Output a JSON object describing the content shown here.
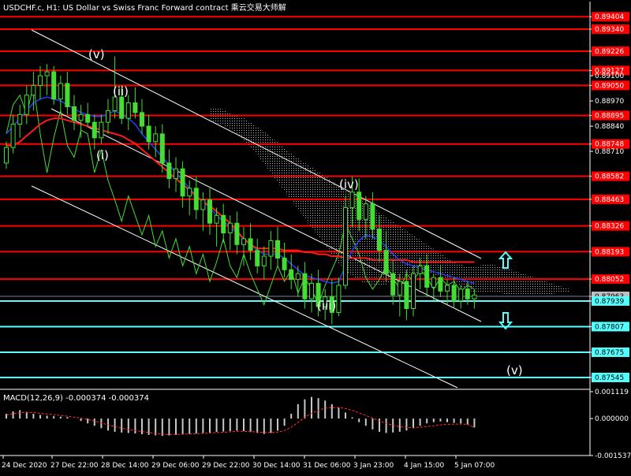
{
  "chart_title": "USDCHF.c, H1: US Dollar vs Swiss Franc Forward contract  乘云交易大师解",
  "indicator_label": "MACD(12,26,9) -0.000374 -0.000374",
  "colors": {
    "background": "#000000",
    "price": "#44dd33",
    "ma_red": "#ff1a1a",
    "ma_blue": "#2040ff",
    "channel": "#ffffff",
    "level_red": "#ff0000",
    "level_cyan": "#55ffff",
    "cloud": "#cccccc",
    "macd_bar": "#c8c8c8",
    "macd_signal": "#ff3030"
  },
  "chart_data": {
    "type": "candlestick",
    "symbol": "USDCHF.c",
    "timeframe": "H1",
    "x_ticks": [
      "24 Dec 2020",
      "27 Dec 22:00",
      "28 Dec 14:00",
      "29 Dec 06:00",
      "29 Dec 22:00",
      "30 Dec 14:00",
      "31 Dec 06:00",
      "3 Jan 23:00",
      "4 Jan 15:00",
      "5 Jan 07:00"
    ],
    "y_range": [
      0.87488,
      0.89482
    ],
    "y_axis_labels": [
      "0.89404",
      "0.89340",
      "0.89226",
      "0.89127",
      "0.89100",
      "0.89050",
      "0.88970",
      "0.88895",
      "0.88840",
      "0.88748",
      "0.88710",
      "0.88582",
      "0.88463",
      "0.88326",
      "0.88193",
      "0.88052",
      "0.87963",
      "0.87939",
      "0.87807",
      "0.87675",
      "0.87545"
    ],
    "resistance_levels": [
      "0.89404",
      "0.89340",
      "0.89226",
      "0.89127",
      "0.89050",
      "0.88895",
      "0.88748",
      "0.88582",
      "0.88463",
      "0.88326",
      "0.88193",
      "0.88052"
    ],
    "support_levels": [
      "0.87939",
      "0.87807",
      "0.87675",
      "0.87545"
    ],
    "current_price": "0.87963",
    "wave_labels": [
      "(v)",
      "(ii)",
      "(i)",
      "(iv)",
      "(iii)",
      "(v)"
    ],
    "arrows": [
      "up",
      "down"
    ],
    "macd": {
      "params": "12,26,9",
      "main": -0.000374,
      "signal": -0.000374,
      "y_labels": [
        "0.001119",
        "0.000000",
        "-0.001537"
      ]
    },
    "series": [
      {
        "type": "candlestick",
        "values": [
          [
            0.8865,
            0.8876,
            0.8862,
            0.8873
          ],
          [
            0.8873,
            0.889,
            0.887,
            0.8885
          ],
          [
            0.8885,
            0.8895,
            0.8878,
            0.889
          ],
          [
            0.889,
            0.8905,
            0.8885,
            0.89
          ],
          [
            0.89,
            0.8912,
            0.8892,
            0.8905
          ],
          [
            0.8905,
            0.8915,
            0.8898,
            0.891
          ],
          [
            0.891,
            0.8916,
            0.89,
            0.8912
          ],
          [
            0.8912,
            0.8915,
            0.8895,
            0.8898
          ],
          [
            0.8898,
            0.891,
            0.8892,
            0.8906
          ],
          [
            0.8906,
            0.8912,
            0.889,
            0.8894
          ],
          [
            0.8894,
            0.89,
            0.8882,
            0.8887
          ],
          [
            0.8887,
            0.8895,
            0.8878,
            0.889
          ],
          [
            0.889,
            0.8896,
            0.8884,
            0.8886
          ],
          [
            0.8886,
            0.889,
            0.8872,
            0.8878
          ],
          [
            0.8878,
            0.889,
            0.8875,
            0.8886
          ],
          [
            0.8886,
            0.8898,
            0.888,
            0.8892
          ],
          [
            0.8892,
            0.892,
            0.8888,
            0.8899
          ],
          [
            0.8899,
            0.8905,
            0.8885,
            0.8888
          ],
          [
            0.8888,
            0.89,
            0.8882,
            0.8896
          ],
          [
            0.8896,
            0.8904,
            0.8888,
            0.8891
          ],
          [
            0.8891,
            0.8898,
            0.888,
            0.8884
          ],
          [
            0.8884,
            0.889,
            0.8872,
            0.8876
          ],
          [
            0.8876,
            0.8884,
            0.8868,
            0.888
          ],
          [
            0.888,
            0.8885,
            0.886,
            0.8865
          ],
          [
            0.8865,
            0.8872,
            0.8852,
            0.8857
          ],
          [
            0.8857,
            0.8868,
            0.885,
            0.8862
          ],
          [
            0.8862,
            0.8866,
            0.8842,
            0.8848
          ],
          [
            0.8848,
            0.8856,
            0.8838,
            0.8852
          ],
          [
            0.8852,
            0.8858,
            0.8836,
            0.8841
          ],
          [
            0.8841,
            0.885,
            0.883,
            0.8846
          ],
          [
            0.8846,
            0.8852,
            0.8828,
            0.8834
          ],
          [
            0.8834,
            0.8842,
            0.8822,
            0.8838
          ],
          [
            0.8838,
            0.8844,
            0.8824,
            0.8829
          ],
          [
            0.8829,
            0.8838,
            0.882,
            0.8834
          ],
          [
            0.8834,
            0.884,
            0.8818,
            0.8823
          ],
          [
            0.8823,
            0.8832,
            0.8812,
            0.8826
          ],
          [
            0.8826,
            0.8834,
            0.8815,
            0.882
          ],
          [
            0.882,
            0.8826,
            0.8808,
            0.8812
          ],
          [
            0.8812,
            0.8822,
            0.8805,
            0.8817
          ],
          [
            0.8817,
            0.883,
            0.881,
            0.8825
          ],
          [
            0.8825,
            0.8832,
            0.8812,
            0.8816
          ],
          [
            0.8816,
            0.8824,
            0.8806,
            0.881
          ],
          [
            0.881,
            0.8818,
            0.88,
            0.8805
          ],
          [
            0.8805,
            0.8812,
            0.8796,
            0.8808
          ],
          [
            0.8808,
            0.8814,
            0.879,
            0.8795
          ],
          [
            0.8795,
            0.8808,
            0.8788,
            0.8803
          ],
          [
            0.8803,
            0.881,
            0.8786,
            0.8791
          ],
          [
            0.8791,
            0.88,
            0.8784,
            0.8796
          ],
          [
            0.8796,
            0.8805,
            0.8782,
            0.8788
          ],
          [
            0.8788,
            0.8806,
            0.8786,
            0.8802
          ],
          [
            0.8802,
            0.8848,
            0.88,
            0.8842
          ],
          [
            0.8842,
            0.8858,
            0.8832,
            0.885
          ],
          [
            0.885,
            0.8857,
            0.883,
            0.8836
          ],
          [
            0.8836,
            0.8848,
            0.8826,
            0.8844
          ],
          [
            0.8844,
            0.885,
            0.8826,
            0.8831
          ],
          [
            0.8831,
            0.8838,
            0.8814,
            0.882
          ],
          [
            0.882,
            0.883,
            0.8804,
            0.8808
          ],
          [
            0.8808,
            0.8815,
            0.8792,
            0.8797
          ],
          [
            0.8797,
            0.8808,
            0.8786,
            0.8804
          ],
          [
            0.8804,
            0.881,
            0.8784,
            0.879
          ],
          [
            0.879,
            0.8812,
            0.8786,
            0.8808
          ],
          [
            0.8808,
            0.8816,
            0.88,
            0.8812
          ],
          [
            0.8812,
            0.8818,
            0.8796,
            0.8801
          ],
          [
            0.8801,
            0.8808,
            0.8794,
            0.8806
          ],
          [
            0.8806,
            0.8812,
            0.8796,
            0.8799
          ],
          [
            0.8799,
            0.8805,
            0.8792,
            0.8802
          ],
          [
            0.8802,
            0.8806,
            0.879,
            0.8794
          ],
          [
            0.8794,
            0.8802,
            0.879,
            0.88
          ],
          [
            0.88,
            0.8804,
            0.8792,
            0.8795
          ],
          [
            0.8795,
            0.88,
            0.879,
            0.8797
          ]
        ]
      },
      {
        "name": "",
        "type": "line",
        "role": "slow_ma",
        "values": [
          0.8874,
          0.8874,
          0.8876,
          0.8879,
          0.8882,
          0.8885,
          0.8887,
          0.8888,
          0.8888,
          0.8887,
          0.8886,
          0.8885,
          0.8884,
          0.8883,
          0.8882,
          0.8881,
          0.888,
          0.8879,
          0.8877,
          0.8875,
          0.8872,
          0.8869,
          0.8866,
          0.8863,
          0.886,
          0.8857,
          0.8854,
          0.8851,
          0.8848,
          0.8845,
          0.8843,
          0.884,
          0.8837,
          0.8834,
          0.883,
          0.8826,
          0.8823,
          0.8821,
          0.8821,
          0.8821,
          0.8821,
          0.882,
          0.882,
          0.882,
          0.8819,
          0.8819,
          0.8818,
          0.8818,
          0.8817,
          0.8817,
          0.8816,
          0.8816,
          0.8816,
          0.8816,
          0.8815,
          0.8815,
          0.8815,
          0.8815,
          0.8815,
          0.8815,
          0.8814,
          0.8814,
          0.8814,
          0.8814,
          0.8814,
          0.8814,
          0.8814,
          0.8814,
          0.8814,
          0.8814
        ]
      },
      {
        "name": "",
        "type": "line",
        "role": "fast_ma",
        "values": [
          0.888,
          0.8884,
          0.8888,
          0.8892,
          0.8896,
          0.8898,
          0.8899,
          0.8898,
          0.8897,
          0.8895,
          0.8893,
          0.8891,
          0.889,
          0.8889,
          0.8889,
          0.889,
          0.8892,
          0.889,
          0.8888,
          0.8885,
          0.888,
          0.8876,
          0.8872,
          0.8868,
          0.8864,
          0.886,
          0.8856,
          0.8852,
          0.8848,
          0.8845,
          0.8842,
          0.8838,
          0.8835,
          0.8832,
          0.8829,
          0.8826,
          0.8823,
          0.882,
          0.8818,
          0.8818,
          0.8818,
          0.8816,
          0.8813,
          0.881,
          0.8807,
          0.8806,
          0.8805,
          0.8804,
          0.8803,
          0.8804,
          0.8812,
          0.882,
          0.8825,
          0.8828,
          0.8827,
          0.8825,
          0.8822,
          0.8818,
          0.8815,
          0.8813,
          0.8812,
          0.8811,
          0.881,
          0.8809,
          0.8808,
          0.8807,
          0.8806,
          0.8805,
          0.8804,
          0.8803
        ]
      },
      {
        "name": "",
        "type": "line",
        "role": "oscillator",
        "values": [
          0.888,
          0.8895,
          0.89,
          0.889,
          0.8905,
          0.888,
          0.886,
          0.8878,
          0.8892,
          0.8874,
          0.8868,
          0.8882,
          0.888,
          0.886,
          0.8872,
          0.8856,
          0.8846,
          0.8835,
          0.8848,
          0.8838,
          0.8828,
          0.8838,
          0.8822,
          0.883,
          0.8816,
          0.8826,
          0.8812,
          0.8822,
          0.8808,
          0.8818,
          0.8804,
          0.8814,
          0.8826,
          0.8812,
          0.8806,
          0.8818,
          0.8808,
          0.88,
          0.8792,
          0.8802,
          0.8812,
          0.8804,
          0.881,
          0.8798,
          0.8806,
          0.88,
          0.8792,
          0.8802,
          0.881,
          0.8818,
          0.8834,
          0.8826,
          0.8818,
          0.8806,
          0.88,
          0.8805,
          0.8812,
          0.8806,
          0.88,
          0.8808,
          0.8804,
          0.881,
          0.8806,
          0.88,
          0.8806,
          0.8802,
          0.8804,
          0.8799,
          0.8802,
          0.88
        ]
      },
      {
        "name": "",
        "type": "histogram",
        "role": "macd_main",
        "values": [
          0.0002,
          0.0003,
          0.00035,
          0.00028,
          0.0002,
          0.00015,
          0.00012,
          0.0001,
          8e-05,
          6e-05,
          0.0,
          -0.0001,
          -0.0002,
          -0.0003,
          -0.0004,
          -0.0005,
          -0.00055,
          -0.00058,
          -0.0006,
          -0.00062,
          -0.00065,
          -0.00068,
          -0.0007,
          -0.00072,
          -0.0007,
          -0.00068,
          -0.00066,
          -0.00064,
          -0.00062,
          -0.0006,
          -0.00058,
          -0.00056,
          -0.00054,
          -0.00052,
          -0.0005,
          -0.00052,
          -0.00056,
          -0.0006,
          -0.00064,
          -0.0006,
          -0.0005,
          -0.0003,
          0.0002,
          0.0006,
          0.0008,
          0.0009,
          0.00085,
          0.00075,
          0.0006,
          0.00045,
          0.00025,
          5e-05,
          -0.00015,
          -0.0003,
          -0.00045,
          -0.00055,
          -0.0006,
          -0.00058,
          -0.00055,
          -0.0005,
          -0.0004,
          -0.0003,
          -0.0002,
          -0.00015,
          -0.00012,
          -0.00015,
          -0.00018,
          -0.0002,
          -0.00025,
          -0.00037
        ]
      },
      {
        "name": "",
        "type": "line",
        "role": "macd_signal",
        "values": [
          0.00015,
          0.0002,
          0.00025,
          0.00026,
          0.00025,
          0.00022,
          0.00019,
          0.00016,
          0.00013,
          0.0001,
          6e-05,
          2e-05,
          -4e-05,
          -0.0001,
          -0.00018,
          -0.00026,
          -0.00033,
          -0.0004,
          -0.00046,
          -0.0005,
          -0.00054,
          -0.00058,
          -0.00062,
          -0.00065,
          -0.00066,
          -0.00066,
          -0.00065,
          -0.00064,
          -0.00063,
          -0.00062,
          -0.0006,
          -0.00059,
          -0.00057,
          -0.00055,
          -0.00053,
          -0.00053,
          -0.00054,
          -0.00056,
          -0.00058,
          -0.00058,
          -0.00056,
          -0.0005,
          -0.00036,
          -0.00016,
          5e-05,
          0.00022,
          0.00035,
          0.00043,
          0.00046,
          0.00046,
          0.00042,
          0.00034,
          0.00024,
          0.00013,
          2e-05,
          -0.0001,
          -0.0002,
          -0.00028,
          -0.00034,
          -0.00037,
          -0.00038,
          -0.00036,
          -0.00033,
          -0.0003,
          -0.00026,
          -0.00024,
          -0.00023,
          -0.00023,
          -0.00024,
          -0.00037
        ]
      },
      {
        "name": "",
        "type": "band",
        "role": "cloud",
        "from_index": 30,
        "to_index": 83,
        "upper": [
          0.8893,
          0.8893,
          0.889,
          0.8888,
          0.8884,
          0.888,
          0.8875,
          0.887,
          0.8866,
          0.8862,
          0.8858,
          0.8854,
          0.885,
          0.8846,
          0.8842,
          0.8838,
          0.8834,
          0.883,
          0.8826,
          0.8822,
          0.8818,
          0.8814,
          0.8812,
          0.8812,
          0.8813,
          0.8812,
          0.881,
          0.8808,
          0.8806,
          0.8804,
          0.8802,
          0.88
        ],
        "lower": [
          0.8886,
          0.8885,
          0.8882,
          0.8876,
          0.887,
          0.8862,
          0.8854,
          0.8846,
          0.8838,
          0.883,
          0.8822,
          0.8814,
          0.8808,
          0.8804,
          0.8802,
          0.8802,
          0.8804,
          0.8806,
          0.8808,
          0.8808,
          0.8806,
          0.8804,
          0.88,
          0.8798,
          0.8798,
          0.8798,
          0.8797,
          0.8797,
          0.8797,
          0.8797,
          0.8798,
          0.8798
        ]
      }
    ]
  }
}
